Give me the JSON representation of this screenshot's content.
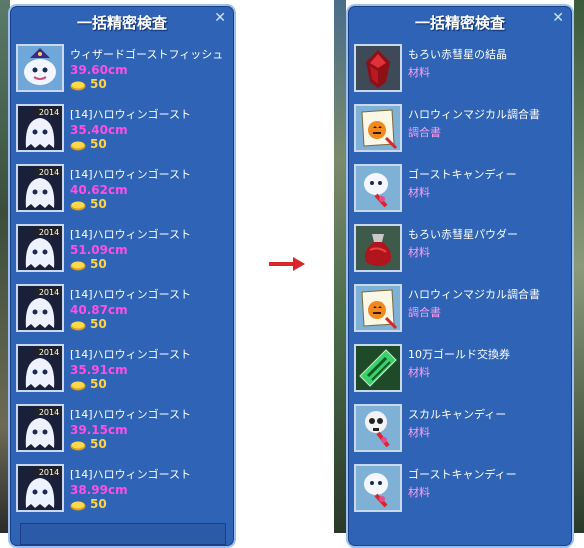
{
  "left_panel": {
    "title": "一括精密検査",
    "close_label": "✕",
    "items": [
      {
        "name": "ウィザードゴーストフィッシュ",
        "size": "39.60cm",
        "price": "50",
        "icon": "wizard-ghost-fish-icon"
      },
      {
        "name": "[14]ハロウィンゴースト",
        "size": "35.40cm",
        "price": "50",
        "icon": "halloween-ghost-icon",
        "badge": "2014"
      },
      {
        "name": "[14]ハロウィンゴースト",
        "size": "40.62cm",
        "price": "50",
        "icon": "halloween-ghost-icon",
        "badge": "2014"
      },
      {
        "name": "[14]ハロウィンゴースト",
        "size": "51.09cm",
        "price": "50",
        "icon": "halloween-ghost-icon",
        "badge": "2014"
      },
      {
        "name": "[14]ハロウィンゴースト",
        "size": "40.87cm",
        "price": "50",
        "icon": "halloween-ghost-icon",
        "badge": "2014"
      },
      {
        "name": "[14]ハロウィンゴースト",
        "size": "35.91cm",
        "price": "50",
        "icon": "halloween-ghost-icon",
        "badge": "2014"
      },
      {
        "name": "[14]ハロウィンゴースト",
        "size": "39.15cm",
        "price": "50",
        "icon": "halloween-ghost-icon",
        "badge": "2014"
      },
      {
        "name": "[14]ハロウィンゴースト",
        "size": "38.99cm",
        "price": "50",
        "icon": "halloween-ghost-icon",
        "badge": "2014"
      }
    ]
  },
  "right_panel": {
    "title": "一括精密検査",
    "close_label": "✕",
    "items": [
      {
        "name": "もろい赤彗星の結晶",
        "category": "材料",
        "icon": "red-crystal-icon"
      },
      {
        "name": "ハロウィンマジカル調合書",
        "category": "調合書",
        "icon": "recipe-scroll-icon"
      },
      {
        "name": "ゴーストキャンディー",
        "category": "材料",
        "icon": "ghost-candy-icon"
      },
      {
        "name": "もろい赤彗星パウダー",
        "category": "材料",
        "icon": "red-powder-bag-icon"
      },
      {
        "name": "ハロウィンマジカル調合書",
        "category": "調合書",
        "icon": "recipe-scroll-icon"
      },
      {
        "name": "10万ゴールド交換券",
        "category": "材料",
        "icon": "gold-ticket-icon"
      },
      {
        "name": "スカルキャンディー",
        "category": "材料",
        "icon": "skull-candy-icon"
      },
      {
        "name": "ゴーストキャンディー",
        "category": "材料",
        "icon": "ghost-candy-icon"
      }
    ]
  },
  "colors": {
    "panel_bg": "#2f63b5",
    "panel_border": "#9cc1ee",
    "size_text": "#ff4fe6",
    "price_text": "#ffd34a",
    "category_text": "#ff9ef4",
    "arrow": "#d8262b"
  },
  "arrow_icon": "right-arrow-icon"
}
